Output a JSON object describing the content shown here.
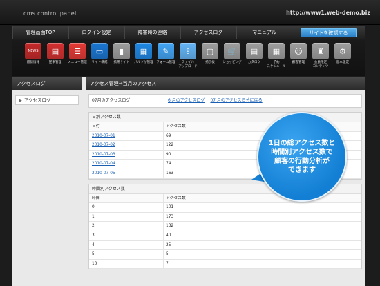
{
  "header": {
    "logo": "cms control panel",
    "url": "http://www1.web-demo.biz"
  },
  "nav": [
    "管理画面TOP",
    "ログイン設定",
    "障害時の連絡",
    "アクセスログ",
    "マニュアル",
    "サイトを確認する"
  ],
  "toolbar": [
    {
      "label": "最新情報",
      "icon": "news-icon",
      "color": "#c62828",
      "glyph": "NEWS"
    },
    {
      "label": "記事管理",
      "icon": "document-icon",
      "color": "#d32f2f",
      "glyph": "▤"
    },
    {
      "label": "メニュー管理",
      "icon": "menu-list-icon",
      "color": "#e53935",
      "glyph": "☰"
    },
    {
      "label": "サイト構成",
      "icon": "monitor-icon",
      "color": "#1976d2",
      "glyph": "▭"
    },
    {
      "label": "携帯サイト",
      "icon": "mobile-icon",
      "color": "#9e9e9e",
      "glyph": "▮"
    },
    {
      "label": "パルツが管理",
      "icon": "parts-icon",
      "color": "#1e88e5",
      "glyph": "▦"
    },
    {
      "label": "フォーム管理",
      "icon": "form-icon",
      "color": "#42a5f5",
      "glyph": "✎"
    },
    {
      "label": "ファイル\nアップロード",
      "icon": "upload-icon",
      "color": "#64b5f6",
      "glyph": "⇪"
    },
    {
      "label": "掲示板",
      "icon": "board-icon",
      "color": "#9e9e9e",
      "glyph": "▢"
    },
    {
      "label": "ショッピング",
      "icon": "cart-icon",
      "color": "#9e9e9e",
      "glyph": "🛒"
    },
    {
      "label": "カタログ",
      "icon": "catalog-icon",
      "color": "#9e9e9e",
      "glyph": "▤"
    },
    {
      "label": "予約\nスケジュール",
      "icon": "calendar-icon",
      "color": "#9e9e9e",
      "glyph": "▦"
    },
    {
      "label": "顧客管理",
      "icon": "customer-icon",
      "color": "#9e9e9e",
      "glyph": "☺"
    },
    {
      "label": "会員限定\nコンテンツ",
      "icon": "members-icon",
      "color": "#9e9e9e",
      "glyph": "♜"
    },
    {
      "label": "基本設定",
      "icon": "settings-icon",
      "color": "#9e9e9e",
      "glyph": "⚙"
    }
  ],
  "sidebar": {
    "title": "アクセスログ",
    "items": [
      {
        "label": "アクセスログ"
      }
    ]
  },
  "content": {
    "title": "アクセス管理→当月のアクセス",
    "month_label": "07月のアクセスログ",
    "links": [
      "6 月のアクセスログ",
      "07 月のアクセス日分に戻る"
    ],
    "daily": {
      "title": "日別アクセス数",
      "headers": [
        "日付",
        "アクセス数"
      ],
      "rows": [
        [
          "2010-07-01",
          "69"
        ],
        [
          "2010-07-02",
          "122"
        ],
        [
          "2010-07-03",
          "90"
        ],
        [
          "2010-07-04",
          "74"
        ],
        [
          "2010-07-05",
          "163"
        ]
      ]
    },
    "hourly": {
      "title": "時間別アクセス数",
      "headers": [
        "時間",
        "アクセス数"
      ],
      "rows": [
        [
          "0",
          "101"
        ],
        [
          "1",
          "173"
        ],
        [
          "2",
          "132"
        ],
        [
          "3",
          "40"
        ],
        [
          "4",
          "25"
        ],
        [
          "5",
          "5"
        ],
        [
          "10",
          "7"
        ]
      ]
    }
  },
  "callout": [
    "1日の総アクセス数と",
    "時間別アクセス数で",
    "顧客の行動分析が",
    "できます"
  ]
}
